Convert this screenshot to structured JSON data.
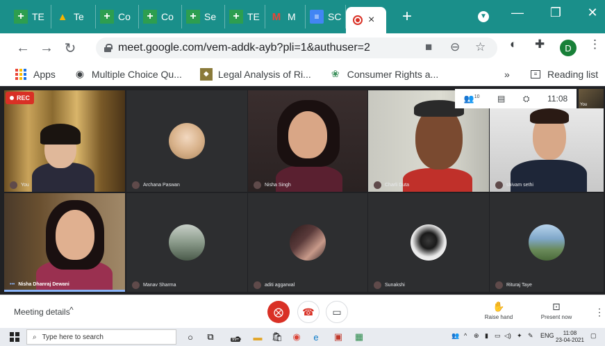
{
  "browser": {
    "tabs": [
      {
        "label": "TE",
        "icon": "classroom-icon",
        "style": "green"
      },
      {
        "label": "Te",
        "icon": "drive-icon",
        "style": "drive"
      },
      {
        "label": "Co",
        "icon": "classroom-icon",
        "style": "green"
      },
      {
        "label": "Co",
        "icon": "classroom-icon",
        "style": "green"
      },
      {
        "label": "Se",
        "icon": "classroom-icon",
        "style": "green"
      },
      {
        "label": "TE",
        "icon": "classroom-icon",
        "style": "green"
      },
      {
        "label": "M",
        "icon": "gmail-icon",
        "style": "gmail"
      },
      {
        "label": "SC",
        "icon": "docs-icon",
        "style": "docs"
      }
    ],
    "active_tab_close": "×",
    "new_tab": "+",
    "url": "meet.google.com/vem-addk-ayb?pli=1&authuser=2",
    "profile_initial": "D",
    "bookmarks": [
      {
        "label": "Apps",
        "icon": "apps-grid-icon"
      },
      {
        "label": "Multiple Choice Qu...",
        "icon": "multiple-choice-icon"
      },
      {
        "label": "Legal Analysis of Ri...",
        "icon": "legal-analysis-icon"
      },
      {
        "label": "Consumer Rights a...",
        "icon": "consumer-rights-icon"
      }
    ],
    "bookmarks_overflow": "»",
    "reading_list": "Reading list"
  },
  "meet": {
    "rec_label": "REC",
    "time": "11:08",
    "people_count": "10",
    "self_thumb_label": "You",
    "participants": [
      {
        "name": "You",
        "type": "video"
      },
      {
        "name": "Archana Paswan",
        "type": "avatar",
        "color": "#d9b38c"
      },
      {
        "name": "Nisha Singh",
        "type": "video"
      },
      {
        "name": "Charli Duta",
        "type": "video"
      },
      {
        "name": "shivam sethi",
        "type": "video"
      },
      {
        "name": "Nisha Dhanraj Dewani",
        "type": "video"
      },
      {
        "name": "Manav Sharma",
        "type": "avatar",
        "color": "#8a9a8a"
      },
      {
        "name": "aditi aggarwal",
        "type": "avatar",
        "color": "#5a3a3a"
      },
      {
        "name": "Sunakshi",
        "type": "avatar",
        "color": "#e8e8e8"
      },
      {
        "name": "Rituraj Taye",
        "type": "avatar",
        "color": "#7fa7c9"
      }
    ],
    "footer": {
      "meeting_details": "Meeting details",
      "raise_hand": "Raise hand",
      "present_now": "Present now"
    }
  },
  "taskbar": {
    "search_placeholder": "Type here to search",
    "badge": "99+",
    "lang": "ENG",
    "time": "11:08",
    "date": "23-04-2021"
  },
  "colors": {
    "tab_strip": "#1a8f8a",
    "meet_bg": "#202124",
    "rec_red": "#d93025"
  }
}
